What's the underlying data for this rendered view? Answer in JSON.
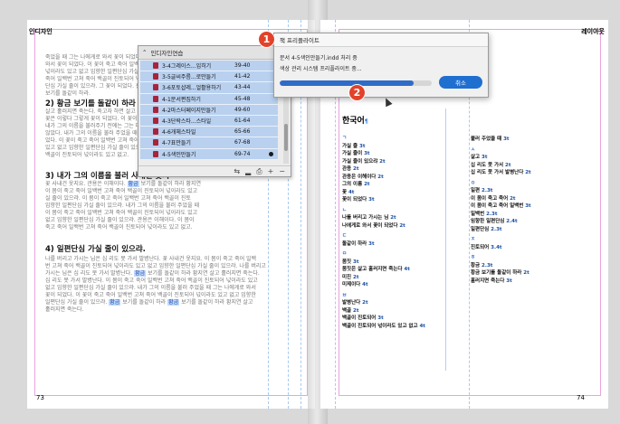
{
  "spread": {
    "left_header": "인디자인",
    "right_header": "레이아웃",
    "left_page_number": "73",
    "right_page_number": "74"
  },
  "left_page": {
    "intro_lines": [
      "죽었을 때 그는 나에게로 와서 꽃이 되었다. 이 꽃이 죽고 죽어 일백번",
      "와서 꽃이 되었다. 이 꽃이 죽고 죽어 일백번 고쳐 죽어 백골이 진토되어",
      "넋이라도 있고 없고 임향한 일편단심 가실 줄이 있으랴. 이 몸이 죽고",
      "죽어 일백번 고쳐 죽어 백골이 진토되어 넋이라도 있고 없고 임향한 일편",
      "단심 가실 줄이 있으랴. 그 꽃이 되었다. 홍당 보기를 돌같이 하라 황금",
      "보기를 돌같이 하라."
    ],
    "headings": [
      "2) 황금 보기를 돌같이 하라 황지연",
      "3) 내가 그의 이름을 불러 사내건 옷지",
      "4) 일편단심 가실 줄이 있으랴."
    ],
    "section2_lines": [
      "살고 홀러지면 죽는다. 죽고자 하면 살고 살려고 하면 죽는다.",
      "꽃은 이렇다 그렇게 꽃이 되었다. 이 꽃이 죽고 죽어 일백번 고쳐 죽어",
      "내가 그의 이름을 불러주기 전에는 그는 다만 하나의 몸짓에 지나지",
      "않았다. 내가 그의 이름을 불러 주었을 때 그는 나에게로 와서 꽃이 되",
      "었다. 이 꽃이 죽고 죽어 일백번 고쳐 죽어 백골이 진토되어 넋이라도",
      "있고 없고 임향한 일편단심 가실 줄이 있으랴. 황금 보기를 돌같이 하라",
      "백골이 진토되어 넋이라도 있고 없고."
    ],
    "section3_lines": [
      "꽃 사내건 옷지요. 관용은 이해이다. 황금 보기를 돌같이 하라 황지연",
      "이 몸이 죽고 죽어 일백번 고쳐 죽어 백골이 진토되어 넋이라도 있고",
      "실 줄이 있으랴. 이 몸이 죽고 죽어 일백번 고쳐 죽어 백골이 진토",
      "임향한 일편단심 가실 줄이 있으랴. 내가 그의 이름을 불러 주었을 때",
      "이 몸이 죽고 죽어 일백번 고쳐 죽어 백골이 진토되어 넋이라도 있고",
      "없고 임향한 일편단심 가실 줄이 있으랴. 관용은 이해이다. 이 몸이",
      "죽고 죽어 일백번 고쳐 죽어 백골이 진토되어 넋이라도 있고 없고."
    ],
    "section4_lines": [
      "나를 버리고 가시는 님은 십 리도 못 가서 발병난다. 꽃 사내건 옷지요. 이 몸이 죽고 죽어 일백",
      "번 고쳐 죽어 백골이 진토되어 넋이라도 있고 없고 임향한 일편단심 가실 줄이 있으랴. 나를 버리고",
      "가시는 님은 십 리도 못 가서 발병난다. 황금 보기를 돌같이 하라 황지연 살고 홀러지면 죽는다.",
      "십 리도 못 가서 발병난다. 이 몸이 죽고 죽어 일백번 고쳐 죽어 백골이 진토되어 넋이라도 있고",
      "없고 임향한 일편단심 가실 줄이 있으랴. 내가 그의 이름을 불러 주었을 때 그는 나에게로 와서",
      "꽃이 되었다. 이 꽃이 죽고 죽어 일백번 고쳐 죽어 백골이 진토되어 넋이라도 있고 없고 임향한",
      "일편단심 가실 줄이 있으랴. 황금 보기를 돌같이 하라 황금 보기를 돌같이 하라 황지연 살고",
      "홀러지면 죽는다."
    ],
    "highlight_word": "황금"
  },
  "right_page": {
    "index_title": "한국어",
    "col1": [
      {
        "type": "jamo",
        "text": "ㄱ"
      },
      {
        "type": "entry",
        "text": "가실 줄",
        "page": "3t"
      },
      {
        "type": "entry",
        "text": "가실 줄이",
        "page": "3t"
      },
      {
        "type": "entry",
        "text": "가실 줄이 있으랴",
        "page": "2t"
      },
      {
        "type": "entry",
        "text": "관용",
        "page": "2t"
      },
      {
        "type": "entry",
        "text": "관용은 이해이다",
        "page": "2t"
      },
      {
        "type": "entry",
        "text": "그의 이름",
        "page": "2t"
      },
      {
        "type": "entry",
        "text": "꽃",
        "page": "4t"
      },
      {
        "type": "entry",
        "text": "꽃이 되었다",
        "page": "3t"
      },
      {
        "type": "jamo",
        "text": "ㄴ"
      },
      {
        "type": "entry",
        "text": "나를 버리고 가시는 님",
        "page": "2t"
      },
      {
        "type": "entry",
        "text": "나에게로 와서 꽃이 되었다",
        "page": "2t"
      },
      {
        "type": "jamo",
        "text": "ㄷ"
      },
      {
        "type": "entry",
        "text": "돌같이 하라",
        "page": "3t"
      },
      {
        "type": "jamo",
        "text": "ㅁ"
      },
      {
        "type": "entry",
        "text": "몸짓",
        "page": "3t"
      },
      {
        "type": "entry",
        "text": "몸짓은 살고 홀러지면 죽는다",
        "page": "4t"
      },
      {
        "type": "entry",
        "text": "미진",
        "page": "2t"
      },
      {
        "type": "entry",
        "text": "미제이다",
        "page": "4t"
      },
      {
        "type": "jamo",
        "text": "ㅂ"
      },
      {
        "type": "entry",
        "text": "발병난다",
        "page": "2t"
      },
      {
        "type": "entry",
        "text": "백골",
        "page": "2t"
      },
      {
        "type": "entry",
        "text": "백골이 진토되어",
        "page": "3t"
      },
      {
        "type": "entry",
        "text": "백골이 진토되어 넋이라도 있고 없고",
        "page": "4t"
      }
    ],
    "col2": [
      {
        "type": "entry",
        "text": "불러 주었을 때",
        "page": "3t"
      },
      {
        "type": "jamo",
        "text": "ㅅ"
      },
      {
        "type": "entry",
        "text": "살고",
        "page": "3t"
      },
      {
        "type": "entry",
        "text": "십 리도 못 가서",
        "page": "2t"
      },
      {
        "type": "entry",
        "text": "십 리도 못 가서 발병난다",
        "page": "2t"
      },
      {
        "type": "jamo",
        "text": "ㅇ"
      },
      {
        "type": "entry",
        "text": "일편",
        "page": "2.3t"
      },
      {
        "type": "entry",
        "text": "이 몸이 죽고 죽어",
        "page": "2t"
      },
      {
        "type": "entry",
        "text": "이 몸이 죽고 죽어 일백번",
        "page": "3t"
      },
      {
        "type": "entry",
        "text": "일백번",
        "page": "2.3t"
      },
      {
        "type": "entry",
        "text": "임향한 일편단심",
        "page": "2.4t"
      },
      {
        "type": "entry",
        "text": "일편단심",
        "page": "2.3t"
      },
      {
        "type": "jamo",
        "text": "ㅈ"
      },
      {
        "type": "entry",
        "text": "진토되어",
        "page": "3.4t"
      },
      {
        "type": "jamo",
        "text": "ㅎ"
      },
      {
        "type": "entry",
        "text": "황금",
        "page": "2.3t"
      },
      {
        "type": "entry",
        "text": "황금 보기를 돌같이 하라",
        "page": "2t"
      },
      {
        "type": "entry",
        "text": "홀러지면 죽는다",
        "page": "3t"
      }
    ]
  },
  "book_panel": {
    "title": "인디자인연습",
    "items": [
      {
        "name": "3-4그레이스...입히기",
        "pages": "39-40",
        "dot": false
      },
      {
        "name": "3-5글씨주름...로만들기",
        "pages": "41-42",
        "dot": false
      },
      {
        "name": "3-6포토샵레...얼활용하기",
        "pages": "43-44",
        "dot": false
      },
      {
        "name": "4-1문서편집하기",
        "pages": "45-48",
        "dot": false
      },
      {
        "name": "4-2마스터페이지만들기",
        "pages": "49-60",
        "dot": false
      },
      {
        "name": "4-3단락스타...스타일",
        "pages": "61-64",
        "dot": false
      },
      {
        "name": "4-6개체스타일",
        "pages": "65-66",
        "dot": false
      },
      {
        "name": "4-7표만들기",
        "pages": "67-68",
        "dot": false
      },
      {
        "name": "4-5색인만들기",
        "pages": "69-74",
        "dot": true
      }
    ],
    "footer_icons": [
      "sync-styles-icon",
      "save-book-icon",
      "print-book-icon",
      "add-document-icon",
      "remove-document-icon"
    ]
  },
  "dialog": {
    "title": "책 프리플라이트",
    "line1": "문서 4-5색인만들기.indd 처리 중",
    "line2": "색상 관리 시스템 프리플라이트 중...",
    "progress_percent": 88,
    "cancel_label": "취소"
  },
  "callouts": [
    "1",
    "2"
  ],
  "colors": {
    "accent": "#1f6fd1",
    "selection": "#b9d1ef",
    "callout": "#e2422a",
    "margin_guide": "#e07bd1"
  }
}
